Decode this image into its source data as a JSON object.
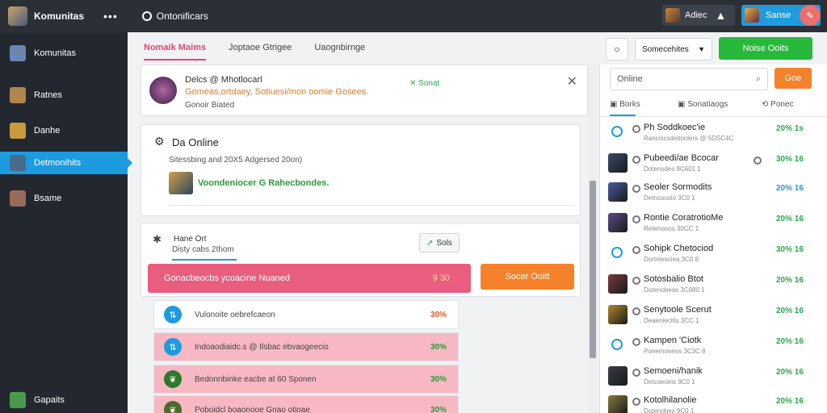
{
  "topbar": {
    "title": "Komunitas",
    "dots": "•••",
    "search_text": "Ontonificars",
    "user_btn_label": "Adiec",
    "user_btn_arrow": "▲",
    "blue_btn_label": "Sanse",
    "notif_icon": "bell-icon",
    "notif_glyph": "✎"
  },
  "sidebar": {
    "items": [
      {
        "label": "Komunitas",
        "icon": "avatar-knight-icon",
        "color": "#6a86b0"
      },
      {
        "label": "Ratnes",
        "icon": "avatar-warrior-icon",
        "color": "#b0864a"
      },
      {
        "label": "Danhe",
        "icon": "avatar-beast-icon",
        "color": "#c89a3a"
      },
      {
        "label": "Detmonihits",
        "icon": "avatar-rogue-icon",
        "color": "#4a6a8a"
      },
      {
        "label": "Bsame",
        "icon": "avatar-mage-icon",
        "color": "#9a6a5a"
      },
      {
        "label": "Gapaits",
        "icon": "avatar-orc-icon",
        "color": "#4a9a4a"
      }
    ]
  },
  "tabs": [
    {
      "label": "Nomaik Maims",
      "active": true
    },
    {
      "label": "Joptaoe Gtrigee",
      "active": false
    },
    {
      "label": "Uaognbirnge",
      "active": false
    }
  ],
  "notice": {
    "line1": "Delcs @ Mhotlocarl",
    "line2": "Gomeas,ortdaey,  Sotiuesi/mon oomie Gosees.",
    "line3": "Gonoir Biated",
    "status": "Sonat",
    "status_icon": "✕",
    "close_glyph": "✕"
  },
  "online": {
    "title": "Da Online",
    "subtitle": "Sitessbing and 20X5 Adgersed 20on)",
    "label": "Voondeniocer  G  Rahecbondes."
  },
  "actions": {
    "title": "Hane Ort",
    "subtitle": "Disty cabs 2thom",
    "small_btn": "Sols",
    "pink_bar_label": "Gonacbeocbs ycoacine Nuaned",
    "pink_bar_value": "9 30",
    "orange_btn": "Socer Ooitt"
  },
  "rows": [
    {
      "text": "Vulonoite oebrefcaeon",
      "value": "30%",
      "value_color": "#e05a2a",
      "icon_bg": "#1d9be0",
      "style": "white"
    },
    {
      "text": "Indoaodiaidc.s @ Ilsbac ebvaogeecio",
      "value": "30%",
      "value_color": "#2a9a3a",
      "icon_bg": "#1d9be0",
      "style": "pink"
    },
    {
      "text": "Bedonnbinke eacbe at 60 Sponen",
      "value": "30%",
      "value_color": "#2a9a3a",
      "icon_bg": "#2a7a2a",
      "style": "pink"
    },
    {
      "text": "Poboidcl boaonooe Gnao otioae",
      "value": "30%",
      "value_color": "#2a9a3a",
      "icon_bg": "#4a6a2a",
      "style": "pink"
    }
  ],
  "right": {
    "top_icon_glyph": "○",
    "select_value": "Somecehites",
    "green_btn": "Noise Ooits",
    "search_placeholder": "Online",
    "search_btn": "Goe",
    "tabs": [
      "Borks",
      "Sonatiaogs",
      "Ponec"
    ],
    "players": [
      {
        "name": "Ph Soddkoec'ie",
        "meta": "Ranciscsdeitonlers @ 5DSC4C",
        "num": "20% 1s",
        "num_color": "#2aa84a",
        "av": "none"
      },
      {
        "name": "Pubeedi/ae Bcocar",
        "meta": "Dotensdes 9C601 1",
        "num": "30% 16",
        "num_color": "#2aa84a",
        "av": "#3a4a6a"
      },
      {
        "name": "Seoler Sormodits",
        "meta": "Detncouslo 3C0 1",
        "num": "20% 16",
        "num_color": "#1d9be0",
        "av": "#4a5aa0"
      },
      {
        "name": "Rontie CoratrotioMe",
        "meta": "Retenonos 30CC 1",
        "num": "20% 16",
        "num_color": "#2aa84a",
        "av": "#5a4a8a"
      },
      {
        "name": "Sohipk Chetociod",
        "meta": "Dortniesciea 3C0 8",
        "num": "30% 16",
        "num_color": "#2aa84a",
        "av": "none"
      },
      {
        "name": "Sotosbalio Btot",
        "meta": "Dotenobeos 3C080 1",
        "num": "20% 16",
        "num_color": "#2aa84a",
        "av": "#7a3a3a"
      },
      {
        "name": "Senytoole Scerut",
        "meta": "Deaeniecitis 3CC 1",
        "num": "20% 16",
        "num_color": "#2aa84a",
        "av": "#b08a2a"
      },
      {
        "name": "Kampen 'Ciotk",
        "meta": "Ponemoneos 3C3C 8",
        "num": "20% 16",
        "num_color": "#2aa84a",
        "av": "none"
      },
      {
        "name": "Semoeni/hanik",
        "meta": "Detcoeoeis 9C0 1",
        "num": "20% 16",
        "num_color": "#2aa84a",
        "av": "#3a3a4a"
      },
      {
        "name": "Kotolhilanolie",
        "meta": "Dotenobes 9C0 1",
        "num": "20% 16",
        "num_color": "#2aa84a",
        "av": "#8a7a3a"
      }
    ]
  }
}
